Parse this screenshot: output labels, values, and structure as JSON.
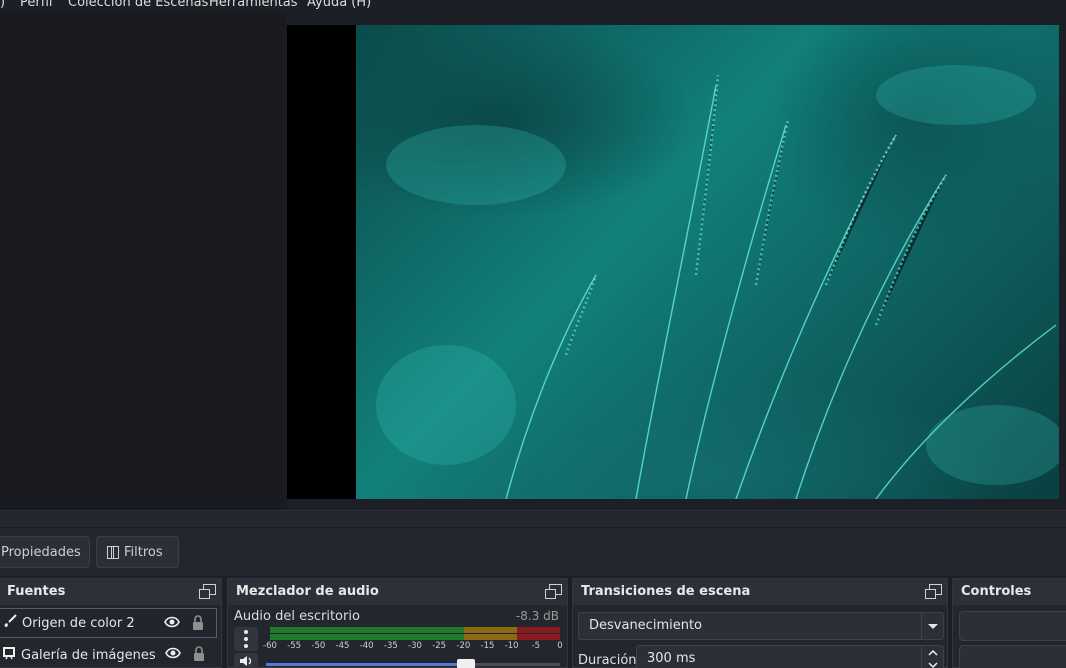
{
  "menubar": {
    "items": [
      {
        "label": ")"
      },
      {
        "label": "Perfil"
      },
      {
        "label": "Colección de Escenas"
      },
      {
        "label": "Herramientas"
      },
      {
        "label": "Ayuda (H)"
      }
    ]
  },
  "toolbar": {
    "properties_label": "Propiedades",
    "filters_label": "Filtros"
  },
  "sources": {
    "title": "Fuentes",
    "items": [
      {
        "label": "Origen de color 2",
        "icon": "brush-icon"
      },
      {
        "label": "Galería de imágenes",
        "icon": "image-gallery-icon"
      }
    ]
  },
  "mixer": {
    "title": "Mezclador de audio",
    "channel": {
      "label": "Audio del escritorio",
      "db": "-8.3 dB",
      "volume_fraction": 0.68
    },
    "ticks": [
      "-60",
      "-55",
      "-50",
      "-45",
      "-40",
      "-35",
      "-30",
      "-25",
      "-20",
      "-15",
      "-10",
      "-5",
      "0"
    ]
  },
  "transitions": {
    "title": "Transiciones de escena",
    "selected": "Desvanecimiento",
    "duration_label": "Duración",
    "duration_value": "300 ms"
  },
  "controls": {
    "title": "Controles"
  },
  "colors": {
    "meter_green": "#1f7a2a",
    "meter_yellow": "#8a6a12",
    "meter_red": "#8a1b23",
    "slider_blue": "#4f79d6"
  }
}
